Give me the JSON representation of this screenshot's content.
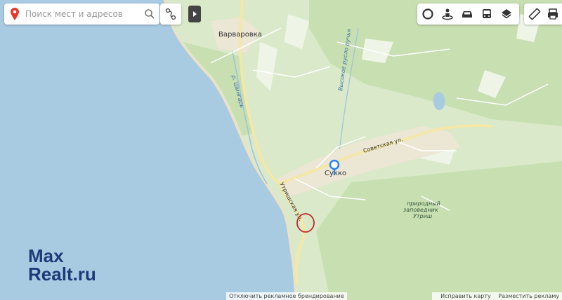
{
  "search": {
    "placeholder": "Поиск мест и адресов"
  },
  "map": {
    "labels": {
      "village_varvarovka": "Варваровка",
      "river_shingar": "р. Шингарь",
      "creek_vysokoe": "Высокое русло ручья",
      "street_sovetskaya": "Советская ул.",
      "street_utrishskaya": "Утришская ул.",
      "place_sukko": "Сукко",
      "reserve_line1": "природный",
      "reserve_line2": "заповедник",
      "reserve_line3": "Утриш"
    }
  },
  "watermark": {
    "line1": "Max",
    "line2": "Realt.ru"
  },
  "ad_bar": {
    "text": "Отключить рекламное брендирование"
  },
  "footer": {
    "feedback": "Исправить карту",
    "ad": "Разместить рекламу"
  },
  "colors": {
    "sea": "#a9cbe2",
    "land": "#d9e9c9",
    "forest": "#c9e0b3",
    "road": "#f3e8a8",
    "marker": "#2b83ef",
    "highlight": "#c02a2a"
  },
  "icons": {
    "search_pin": "location-pin-icon",
    "search": "search-icon",
    "route": "route-icon",
    "collapse": "play-icon",
    "traffic": "traffic-icon",
    "panorama": "panorama-icon",
    "taxi": "car-icon",
    "transit": "bus-icon",
    "layers": "layers-icon",
    "ruler": "ruler-icon",
    "print": "print-icon"
  }
}
